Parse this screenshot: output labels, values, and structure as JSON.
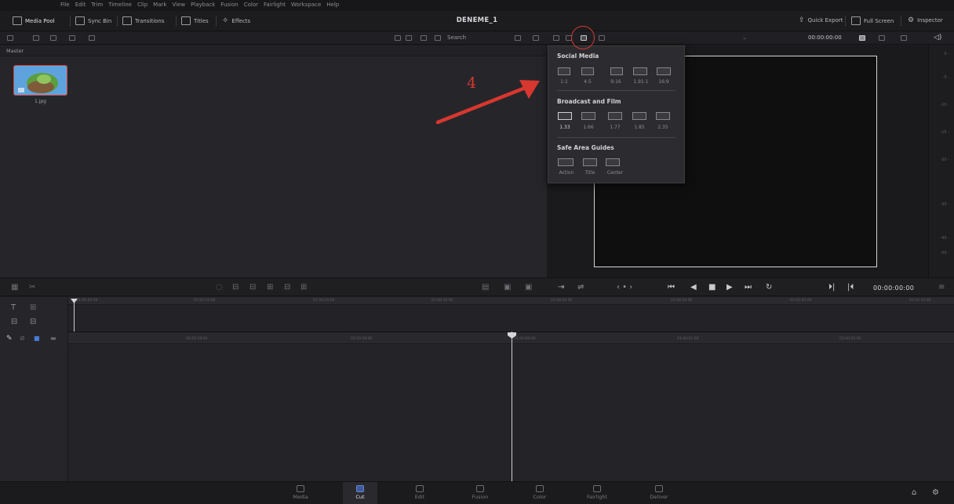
{
  "menu": [
    "File",
    "Edit",
    "Trim",
    "Timeline",
    "Clip",
    "Mark",
    "View",
    "Playback",
    "Fusion",
    "Color",
    "Fairlight",
    "Workspace",
    "Help"
  ],
  "toolbar": {
    "media_pool": "Media Pool",
    "sync_bin": "Sync Bin",
    "transitions": "Transitions",
    "titles": "Titles",
    "effects": "Effects",
    "project_title": "DENEME_1",
    "quick_export": "Quick Export",
    "full_screen": "Full Screen",
    "inspector": "Inspector"
  },
  "subbar": {
    "search_label": "Search",
    "timecode": "00:00:00:00"
  },
  "media_pool": {
    "bin_label": "Master",
    "clips": [
      {
        "name": "1.jpg"
      }
    ]
  },
  "aspect_menu": {
    "social_media_title": "Social Media",
    "social_media": [
      "1:1",
      "4:5",
      "9:16",
      "1.91:1",
      "16:9"
    ],
    "broadcast_title": "Broadcast and Film",
    "broadcast": [
      "1.33",
      "1.66",
      "1.77",
      "1.85",
      "2.35"
    ],
    "safe_area_title": "Safe Area Guides",
    "safe_area": [
      "Action",
      "Title",
      "Center"
    ]
  },
  "audio_meter": [
    "0 -",
    "-5 -",
    "-10 -",
    "-15 -",
    "-20 -",
    "-30 -",
    "-40 -",
    "-50 -"
  ],
  "transport": {
    "timecode": "00:00:00:00"
  },
  "timeline": {
    "upper_ticks": [
      "01:00:00:00",
      "01:00:10:00",
      "01:00:20:00",
      "01:00:30:00",
      "01:00:40:00",
      "01:00:50:00",
      "01:01:00:00",
      "01:01:10:00"
    ],
    "lower_ticks": [
      "00:59:58:00",
      "00:59:59:00",
      "01:00:00:00",
      "01:00:01:00",
      "01:00:02:00"
    ]
  },
  "pages": [
    {
      "label": "Media",
      "active": false
    },
    {
      "label": "Cut",
      "active": true
    },
    {
      "label": "Edit",
      "active": false
    },
    {
      "label": "Fusion",
      "active": false
    },
    {
      "label": "Color",
      "active": false
    },
    {
      "label": "Fairlight",
      "active": false
    },
    {
      "label": "Deliver",
      "active": false
    }
  ],
  "annotation": {
    "number": "4",
    "color": "#d8372f"
  },
  "colors": {
    "accent": "#3c5a9e",
    "highlight_red": "#d9453b"
  }
}
